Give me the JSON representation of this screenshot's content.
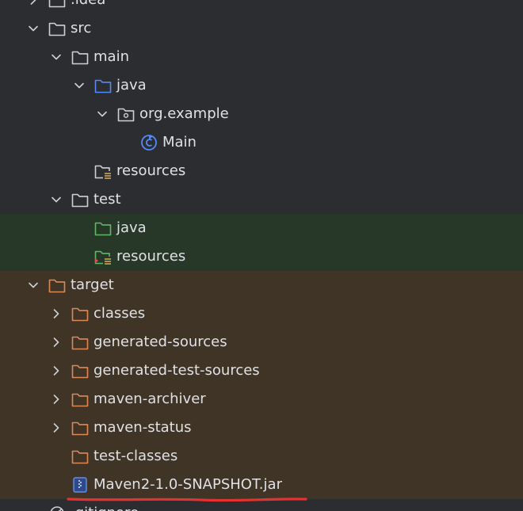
{
  "project_tree": {
    "nodes": [
      {
        "id": "idea",
        "label": ".idea",
        "depth": 0,
        "expander": "right",
        "icon": "folder-icon",
        "row_bg": "none"
      },
      {
        "id": "src",
        "label": "src",
        "depth": 0,
        "expander": "down",
        "icon": "folder-icon",
        "row_bg": "none"
      },
      {
        "id": "main",
        "label": "main",
        "depth": 1,
        "expander": "down",
        "icon": "folder-icon",
        "row_bg": "none"
      },
      {
        "id": "java-main",
        "label": "java",
        "depth": 2,
        "expander": "down",
        "icon": "source-folder-icon",
        "row_bg": "none"
      },
      {
        "id": "org-example",
        "label": "org.example",
        "depth": 3,
        "expander": "down",
        "icon": "package-icon",
        "row_bg": "none"
      },
      {
        "id": "main-class",
        "label": "Main",
        "depth": 4,
        "expander": "none",
        "icon": "java-class-icon",
        "row_bg": "none"
      },
      {
        "id": "resources-main",
        "label": "resources",
        "depth": 2,
        "expander": "none",
        "icon": "resources-folder-icon",
        "row_bg": "none"
      },
      {
        "id": "test",
        "label": "test",
        "depth": 1,
        "expander": "down",
        "icon": "folder-icon",
        "row_bg": "none"
      },
      {
        "id": "java-test",
        "label": "java",
        "depth": 2,
        "expander": "none",
        "icon": "test-source-folder-icon",
        "row_bg": "test"
      },
      {
        "id": "resources-test",
        "label": "resources",
        "depth": 2,
        "expander": "none",
        "icon": "test-resources-folder-icon",
        "row_bg": "test"
      },
      {
        "id": "target",
        "label": "target",
        "depth": 0,
        "expander": "down",
        "icon": "excluded-folder-icon",
        "row_bg": "excluded"
      },
      {
        "id": "classes",
        "label": "classes",
        "depth": 1,
        "expander": "right",
        "icon": "excluded-folder-icon",
        "row_bg": "excluded"
      },
      {
        "id": "generated-sources",
        "label": "generated-sources",
        "depth": 1,
        "expander": "right",
        "icon": "excluded-folder-icon",
        "row_bg": "excluded"
      },
      {
        "id": "generated-test-sources",
        "label": "generated-test-sources",
        "depth": 1,
        "expander": "right",
        "icon": "excluded-folder-icon",
        "row_bg": "excluded"
      },
      {
        "id": "maven-archiver",
        "label": "maven-archiver",
        "depth": 1,
        "expander": "right",
        "icon": "excluded-folder-icon",
        "row_bg": "excluded"
      },
      {
        "id": "maven-status",
        "label": "maven-status",
        "depth": 1,
        "expander": "right",
        "icon": "excluded-folder-icon",
        "row_bg": "excluded"
      },
      {
        "id": "test-classes",
        "label": "test-classes",
        "depth": 1,
        "expander": "none",
        "icon": "excluded-folder-icon",
        "row_bg": "excluded"
      },
      {
        "id": "jar",
        "label": "Maven2-1.0-SNAPSHOT.jar",
        "depth": 1,
        "expander": "none",
        "icon": "jar-file-icon",
        "row_bg": "excluded"
      },
      {
        "id": "gitignore",
        "label": ".gitignore",
        "depth": 0,
        "expander": "none",
        "icon": "ignore-file-icon",
        "row_bg": "none"
      }
    ]
  },
  "annotation": {
    "underline_color": "#e5312f",
    "underlined_item": "Maven2-1.0-SNAPSHOT.jar"
  },
  "colors": {
    "background": "#2b2d30",
    "text": "#dfe1e5",
    "test_row_bg": "#273828",
    "excluded_row_bg": "#3f3426",
    "folder_stroke": "#ced0d6",
    "source_folder_stroke": "#548af7",
    "test_folder_stroke": "#5fb865",
    "excluded_folder_stroke": "#e08855",
    "resources_lines": "#d6ae58",
    "class_icon": "#548af7"
  }
}
